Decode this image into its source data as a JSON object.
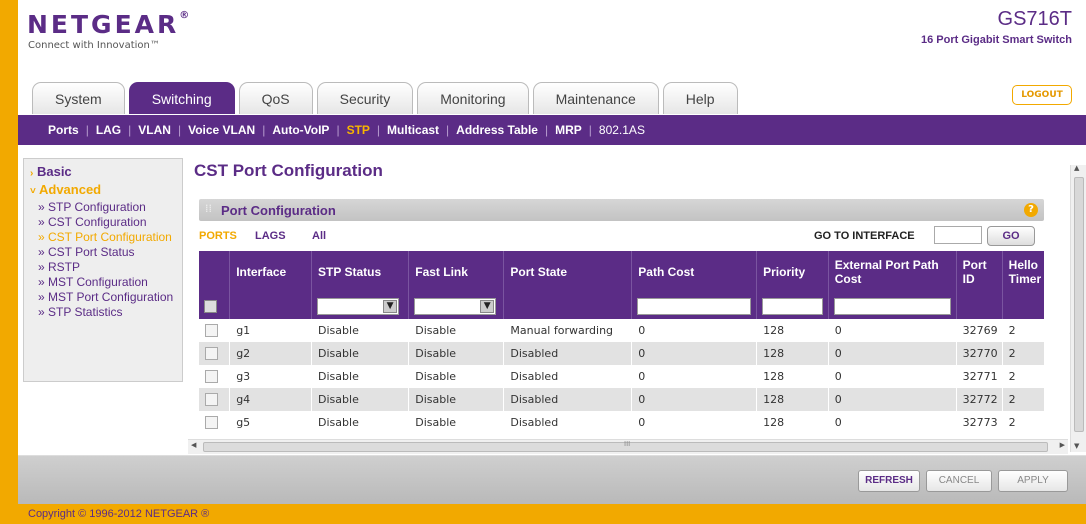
{
  "brand": {
    "logo": "NETGEAR",
    "registered": "®",
    "tagline": "Connect with Innovation™",
    "model": "GS716T",
    "model_desc": "16 Port Gigabit Smart Switch",
    "accent": "#5b2c86",
    "orange": "#f2a900"
  },
  "tabs": [
    {
      "label": "System",
      "active": false
    },
    {
      "label": "Switching",
      "active": true
    },
    {
      "label": "QoS",
      "active": false
    },
    {
      "label": "Security",
      "active": false
    },
    {
      "label": "Monitoring",
      "active": false
    },
    {
      "label": "Maintenance",
      "active": false
    },
    {
      "label": "Help",
      "active": false
    }
  ],
  "logout_label": "LOGOUT",
  "subnav": [
    {
      "label": "Ports",
      "active": false
    },
    {
      "label": "LAG",
      "active": false
    },
    {
      "label": "VLAN",
      "active": false
    },
    {
      "label": "Voice VLAN",
      "active": false
    },
    {
      "label": "Auto-VoIP",
      "active": false
    },
    {
      "label": "STP",
      "active": true
    },
    {
      "label": "Multicast",
      "active": false
    },
    {
      "label": "Address Table",
      "active": false
    },
    {
      "label": "MRP",
      "active": false
    },
    {
      "label": "802.1AS",
      "active": false
    }
  ],
  "sidebar": {
    "basic": "Basic",
    "advanced": "Advanced",
    "items": [
      {
        "label": "STP Configuration",
        "active": false
      },
      {
        "label": "CST Configuration",
        "active": false
      },
      {
        "label": "CST Port Configuration",
        "active": true
      },
      {
        "label": "CST Port Status",
        "active": false
      },
      {
        "label": "RSTP",
        "active": false
      },
      {
        "label": "MST Configuration",
        "active": false
      },
      {
        "label": "MST Port Configuration",
        "active": false
      },
      {
        "label": "STP Statistics",
        "active": false
      }
    ]
  },
  "page": {
    "title": "CST Port Configuration",
    "panel_title": "Port Configuration",
    "help": "?",
    "filters": {
      "ports": "PORTS",
      "lags": "LAGS",
      "all": "All"
    },
    "goto_label": "GO TO INTERFACE",
    "goto_button": "GO"
  },
  "table": {
    "headers": [
      "",
      "Interface",
      "STP Status",
      "Fast Link",
      "Port State",
      "Path Cost",
      "Priority",
      "External Port Path Cost",
      "Port ID",
      "Hello Timer"
    ],
    "rows": [
      {
        "interface": "g1",
        "stp": "Disable",
        "fast": "Disable",
        "state": "Manual forwarding",
        "cost": "0",
        "prio": "128",
        "ext": "0",
        "pid": "32769",
        "hello": "2"
      },
      {
        "interface": "g2",
        "stp": "Disable",
        "fast": "Disable",
        "state": "Disabled",
        "cost": "0",
        "prio": "128",
        "ext": "0",
        "pid": "32770",
        "hello": "2"
      },
      {
        "interface": "g3",
        "stp": "Disable",
        "fast": "Disable",
        "state": "Disabled",
        "cost": "0",
        "prio": "128",
        "ext": "0",
        "pid": "32771",
        "hello": "2"
      },
      {
        "interface": "g4",
        "stp": "Disable",
        "fast": "Disable",
        "state": "Disabled",
        "cost": "0",
        "prio": "128",
        "ext": "0",
        "pid": "32772",
        "hello": "2"
      },
      {
        "interface": "g5",
        "stp": "Disable",
        "fast": "Disable",
        "state": "Disabled",
        "cost": "0",
        "prio": "128",
        "ext": "0",
        "pid": "32773",
        "hello": "2"
      }
    ]
  },
  "buttons": {
    "refresh": "REFRESH",
    "cancel": "CANCEL",
    "apply": "APPLY"
  },
  "copyright": "Copyright © 1996-2012 NETGEAR ®",
  "icons": {
    "help": "help-icon",
    "scroll_up": "▲",
    "scroll_down": "▼",
    "scroll_left": "◀",
    "scroll_right": "▶",
    "hscroll_grip": "III"
  }
}
